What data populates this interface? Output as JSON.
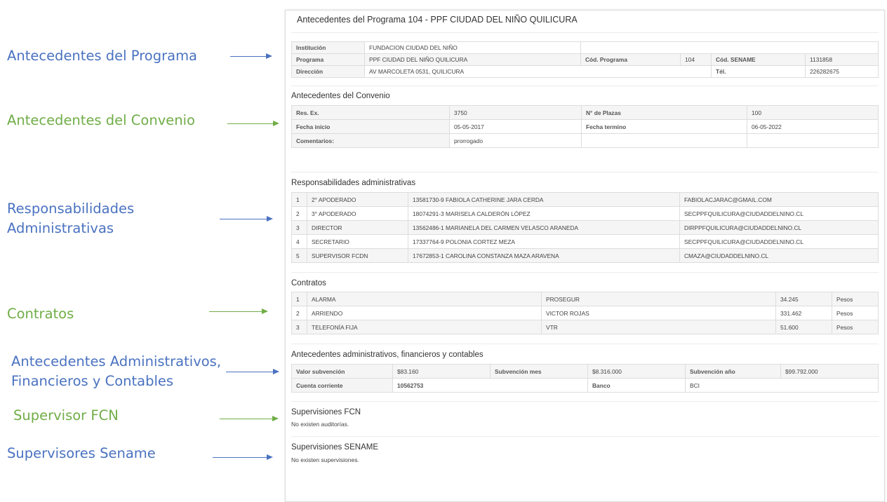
{
  "annotations": [
    {
      "text": "Antecedentes del Programa"
    },
    {
      "text": "Antecedentes del Convenio"
    },
    {
      "text": "Responsabilidades\nAdministrativas"
    },
    {
      "text": "Contratos"
    },
    {
      "text": "Antecedentes Administrativos,\nFinancieros y Contables"
    },
    {
      "text": "Supervisor FCN"
    },
    {
      "text": "Supervisores Sename"
    }
  ],
  "colors": {
    "blue": "#4a72c0",
    "green": "#70ad47"
  },
  "panel": {
    "title": "Antecedentes del Programa 104 - PPF CIUDAD DEL NIÑO QUILICURA",
    "programa": {
      "institucion_label": "Institución",
      "institucion_value": "FUNDACION CIUDAD DEL NIÑO",
      "programa_label": "Programa",
      "programa_value": "PPF CIUDAD DEL NIÑO QUILICURA",
      "cod_programa_label": "Cód. Programa",
      "cod_programa_value": "104",
      "cod_sename_label": "Cód. SENAME",
      "cod_sename_value": "1131858",
      "direccion_label": "Dirección",
      "direccion_value": "AV MARCOLETA 0531, QUILICURA",
      "tel_label": "Tél.",
      "tel_value": "226282675"
    },
    "convenio": {
      "title": "Antecedentes del Convenio",
      "res_ex_label": "Res. Ex.",
      "res_ex_value": "3750",
      "plazas_label": "N° de Plazas",
      "plazas_value": "100",
      "fecha_inicio_label": "Fecha inicio",
      "fecha_inicio_value": "05-05-2017",
      "fecha_termino_label": "Fecha termino",
      "fecha_termino_value": "06-05-2022",
      "comentarios_label": "Comentarios:",
      "comentarios_value": "prorrogado"
    },
    "responsabilidades": {
      "title": "Responsabilidades administrativas",
      "rows": [
        {
          "n": "1",
          "cargo": "2° APODERADO",
          "persona": "13581730-9 FABIOLA CATHERINE JARA CERDA",
          "email": "FABIOLACJARAC@GMAIL.COM"
        },
        {
          "n": "2",
          "cargo": "3° APODERADO",
          "persona": "18074291-3 MARISELA CALDERÓN LÓPEZ",
          "email": "SECPPFQUILICURA@CIUDADDELNINO.CL"
        },
        {
          "n": "3",
          "cargo": "DIRECTOR",
          "persona": "13562486-1 MARIANELA DEL CARMEN VELASCO ARANEDA",
          "email": "DIRPPFQUILICURA@CIUDADDELNINO.CL"
        },
        {
          "n": "4",
          "cargo": "SECRETARIO",
          "persona": "17337764-9 POLONIA CORTEZ MEZA",
          "email": "SECPPFQUILICURA@CIUDADDELNINO.CL"
        },
        {
          "n": "5",
          "cargo": "SUPERVISOR FCDN",
          "persona": "17672853-1 CAROLINA CONSTANZA MAZA ARAVENA",
          "email": "CMAZA@CIUDADDELNINO.CL"
        }
      ]
    },
    "contratos": {
      "title": "Contratos",
      "rows": [
        {
          "n": "1",
          "tipo": "ALARMA",
          "proveedor": "PROSEGUR",
          "monto": "34.245",
          "moneda": "Pesos"
        },
        {
          "n": "2",
          "tipo": "ARRIENDO",
          "proveedor": "VICTOR ROJAS",
          "monto": "331.462",
          "moneda": "Pesos"
        },
        {
          "n": "3",
          "tipo": "TELEFONÍA FIJA",
          "proveedor": "VTR",
          "monto": "51.600",
          "moneda": "Pesos"
        }
      ]
    },
    "financieros": {
      "title": "Antecedentes administrativos, financieros y contables",
      "valor_label": "Valor subvención",
      "valor_value": "$83.160",
      "mes_label": "Subvención mes",
      "mes_value": "$8.316.000",
      "anio_label": "Subvención año",
      "anio_value": "$99.792.000",
      "cuenta_label": "Cuenta corriente",
      "cuenta_value": "10562753",
      "banco_label": "Banco",
      "banco_value": "BCI"
    },
    "supervisiones_fcn": {
      "title": "Supervisiones FCN",
      "empty": "No existen auditorías."
    },
    "supervisiones_sename": {
      "title": "Supervisiones SENAME",
      "empty": "No existen supervisiones."
    }
  }
}
